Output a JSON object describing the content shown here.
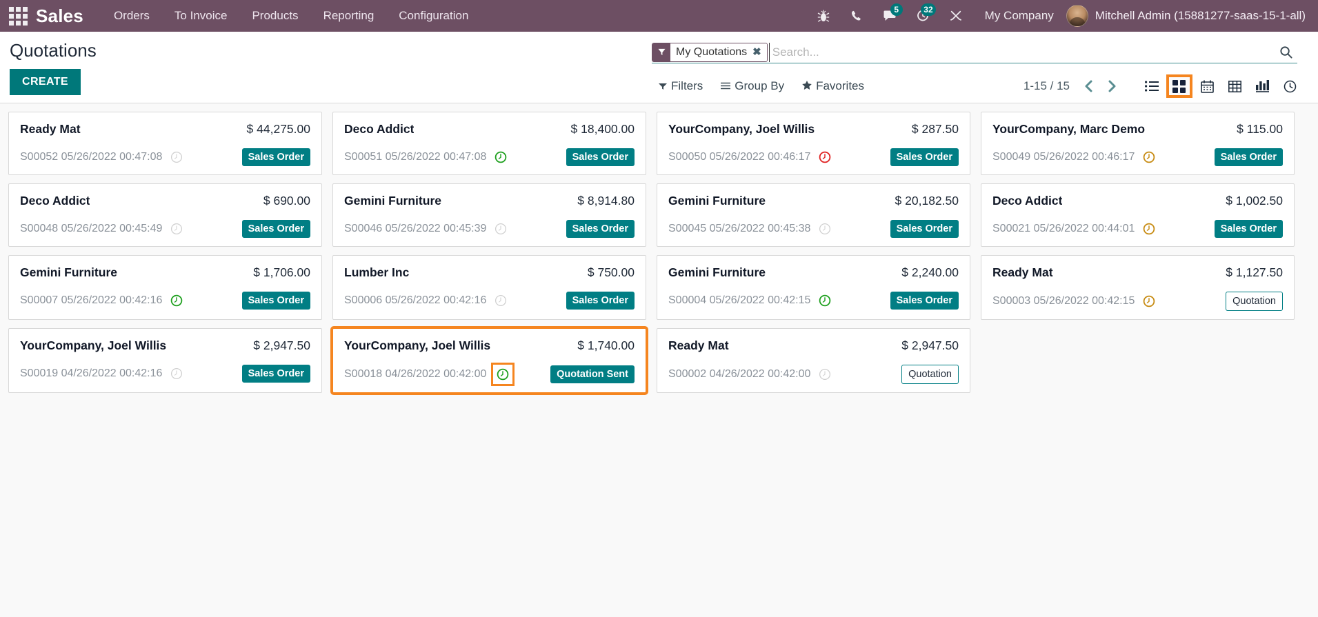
{
  "navbar": {
    "apps_icon": "apps-grid-icon",
    "brand": "Sales",
    "menus": [
      "Orders",
      "To Invoice",
      "Products",
      "Reporting",
      "Configuration"
    ],
    "sys_icons": [
      {
        "name": "bug-icon",
        "badge": null
      },
      {
        "name": "phone-icon",
        "badge": null
      },
      {
        "name": "messages-icon",
        "badge": "5"
      },
      {
        "name": "activities-clock-icon",
        "badge": "32"
      },
      {
        "name": "tools-icon",
        "badge": null
      }
    ],
    "company": "My Company",
    "user": "Mitchell Admin (15881277-saas-15-1-all)"
  },
  "control_panel": {
    "title": "Quotations",
    "create_label": "CREATE",
    "search": {
      "facet_icon": "filter-funnel-icon",
      "facet_label": "My Quotations",
      "facet_close": "✖",
      "placeholder": "Search...",
      "value": "",
      "search_icon": "search-icon"
    },
    "menu": [
      {
        "label": "Filters",
        "icon": "filter-caret-icon"
      },
      {
        "label": "Group By",
        "icon": "hamburger-icon"
      },
      {
        "label": "Favorites",
        "icon": "star-icon"
      }
    ],
    "pager": "1-15 / 15",
    "prev_icon": "chevron-left-icon",
    "next_icon": "chevron-right-icon",
    "views": [
      {
        "name": "list-view",
        "icon": "list-icon",
        "active": false
      },
      {
        "name": "kanban-view",
        "icon": "kanban-grid-icon",
        "active": true
      },
      {
        "name": "calendar-view",
        "icon": "calendar-icon",
        "active": false
      },
      {
        "name": "pivot-view",
        "icon": "pivot-table-icon",
        "active": false
      },
      {
        "name": "graph-view",
        "icon": "bar-chart-icon",
        "active": false
      },
      {
        "name": "activity-view",
        "icon": "clock-icon",
        "active": false
      }
    ]
  },
  "colors": {
    "navbar_bg": "#6d4f63",
    "accent_teal": "#00787a",
    "highlight_orange": "#f5851f",
    "clock_green": "#1fa01f",
    "clock_red": "#e02020",
    "clock_amber": "#c78b12",
    "clock_grey": "#cfcfcf"
  },
  "cards": [
    {
      "partner": "Ready Mat",
      "amount": "$ 44,275.00",
      "ref": "S00052 05/26/2022 00:47:08",
      "clock": "grey",
      "state": "Sales Order",
      "state_style": "solid",
      "highlight": false,
      "clock_boxed": false
    },
    {
      "partner": "Deco Addict",
      "amount": "$ 18,400.00",
      "ref": "S00051 05/26/2022 00:47:08",
      "clock": "green",
      "state": "Sales Order",
      "state_style": "solid",
      "highlight": false,
      "clock_boxed": false
    },
    {
      "partner": "YourCompany, Joel Willis",
      "amount": "$ 287.50",
      "ref": "S00050 05/26/2022 00:46:17",
      "clock": "red",
      "state": "Sales Order",
      "state_style": "solid",
      "highlight": false,
      "clock_boxed": false
    },
    {
      "partner": "YourCompany, Marc Demo",
      "amount": "$ 115.00",
      "ref": "S00049 05/26/2022 00:46:17",
      "clock": "amber",
      "state": "Sales Order",
      "state_style": "solid",
      "highlight": false,
      "clock_boxed": false
    },
    {
      "partner": "Deco Addict",
      "amount": "$ 690.00",
      "ref": "S00048 05/26/2022 00:45:49",
      "clock": "grey",
      "state": "Sales Order",
      "state_style": "solid",
      "highlight": false,
      "clock_boxed": false
    },
    {
      "partner": "Gemini Furniture",
      "amount": "$ 8,914.80",
      "ref": "S00046 05/26/2022 00:45:39",
      "clock": "grey",
      "state": "Sales Order",
      "state_style": "solid",
      "highlight": false,
      "clock_boxed": false
    },
    {
      "partner": "Gemini Furniture",
      "amount": "$ 20,182.50",
      "ref": "S00045 05/26/2022 00:45:38",
      "clock": "grey",
      "state": "Sales Order",
      "state_style": "solid",
      "highlight": false,
      "clock_boxed": false
    },
    {
      "partner": "Deco Addict",
      "amount": "$ 1,002.50",
      "ref": "S00021 05/26/2022 00:44:01",
      "clock": "amber",
      "state": "Sales Order",
      "state_style": "solid",
      "highlight": false,
      "clock_boxed": false
    },
    {
      "partner": "Gemini Furniture",
      "amount": "$ 1,706.00",
      "ref": "S00007 05/26/2022 00:42:16",
      "clock": "green",
      "state": "Sales Order",
      "state_style": "solid",
      "highlight": false,
      "clock_boxed": false
    },
    {
      "partner": "Lumber Inc",
      "amount": "$ 750.00",
      "ref": "S00006 05/26/2022 00:42:16",
      "clock": "grey",
      "state": "Sales Order",
      "state_style": "solid",
      "highlight": false,
      "clock_boxed": false
    },
    {
      "partner": "Gemini Furniture",
      "amount": "$ 2,240.00",
      "ref": "S00004 05/26/2022 00:42:15",
      "clock": "green",
      "state": "Sales Order",
      "state_style": "solid",
      "highlight": false,
      "clock_boxed": false
    },
    {
      "partner": "Ready Mat",
      "amount": "$ 1,127.50",
      "ref": "S00003 05/26/2022 00:42:15",
      "clock": "amber",
      "state": "Quotation",
      "state_style": "outline",
      "highlight": false,
      "clock_boxed": false
    },
    {
      "partner": "YourCompany, Joel Willis",
      "amount": "$ 2,947.50",
      "ref": "S00019 04/26/2022 00:42:16",
      "clock": "grey",
      "state": "Sales Order",
      "state_style": "solid",
      "highlight": false,
      "clock_boxed": false
    },
    {
      "partner": "YourCompany, Joel Willis",
      "amount": "$ 1,740.00",
      "ref": "S00018 04/26/2022 00:42:00",
      "clock": "green",
      "state": "Quotation Sent",
      "state_style": "solid",
      "highlight": true,
      "clock_boxed": true
    },
    {
      "partner": "Ready Mat",
      "amount": "$ 2,947.50",
      "ref": "S00002 04/26/2022 00:42:00",
      "clock": "grey",
      "state": "Quotation",
      "state_style": "outline",
      "highlight": false,
      "clock_boxed": false
    }
  ]
}
